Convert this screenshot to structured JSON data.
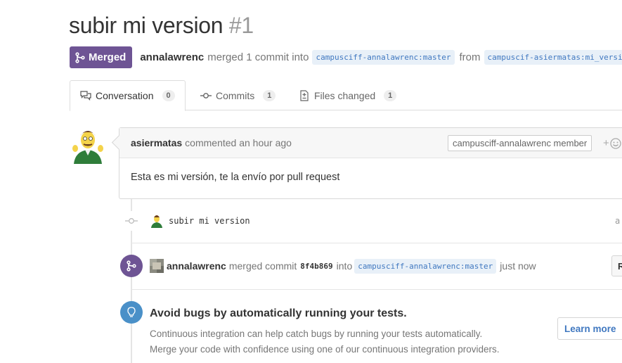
{
  "pr": {
    "title": "subir mi version",
    "number": "#1",
    "state": "Merged",
    "author": "annalawrenc",
    "merged_text": "merged 1 commit into",
    "base_branch": "campusciff-annalawrenc:master",
    "from_text": "from",
    "head_branch": "campuscif-asiermatas:mi_version"
  },
  "tabs": [
    {
      "label": "Conversation",
      "count": "0",
      "icon": "comment-discussion-icon"
    },
    {
      "label": "Commits",
      "count": "1",
      "icon": "git-commit-icon"
    },
    {
      "label": "Files changed",
      "count": "1",
      "icon": "file-diff-icon"
    }
  ],
  "comment": {
    "author": "asiermatas",
    "meta": "commented an hour ago",
    "label": "campusciff-annalawrenc member",
    "reaction": "+",
    "body": "Esta es mi versión, te la envío por pull request"
  },
  "commit": {
    "message": "subir mi version",
    "date_partial": "a"
  },
  "merge_event": {
    "author": "annalawrenc",
    "text": "merged commit",
    "sha": "8f4b869",
    "into": "into",
    "branch": "campusciff-annalawrenc:master",
    "time": "just now",
    "button": "R"
  },
  "ci": {
    "title": "Avoid bugs by automatically running your tests.",
    "line1": "Continuous integration can help catch bugs by running your tests automatically.",
    "line2": "Merge your code with confidence using one of our continuous integration providers.",
    "button": "Learn more"
  },
  "colors": {
    "merged": "#6e5494",
    "link": "#4078c0",
    "ci": "#4a90c8"
  }
}
